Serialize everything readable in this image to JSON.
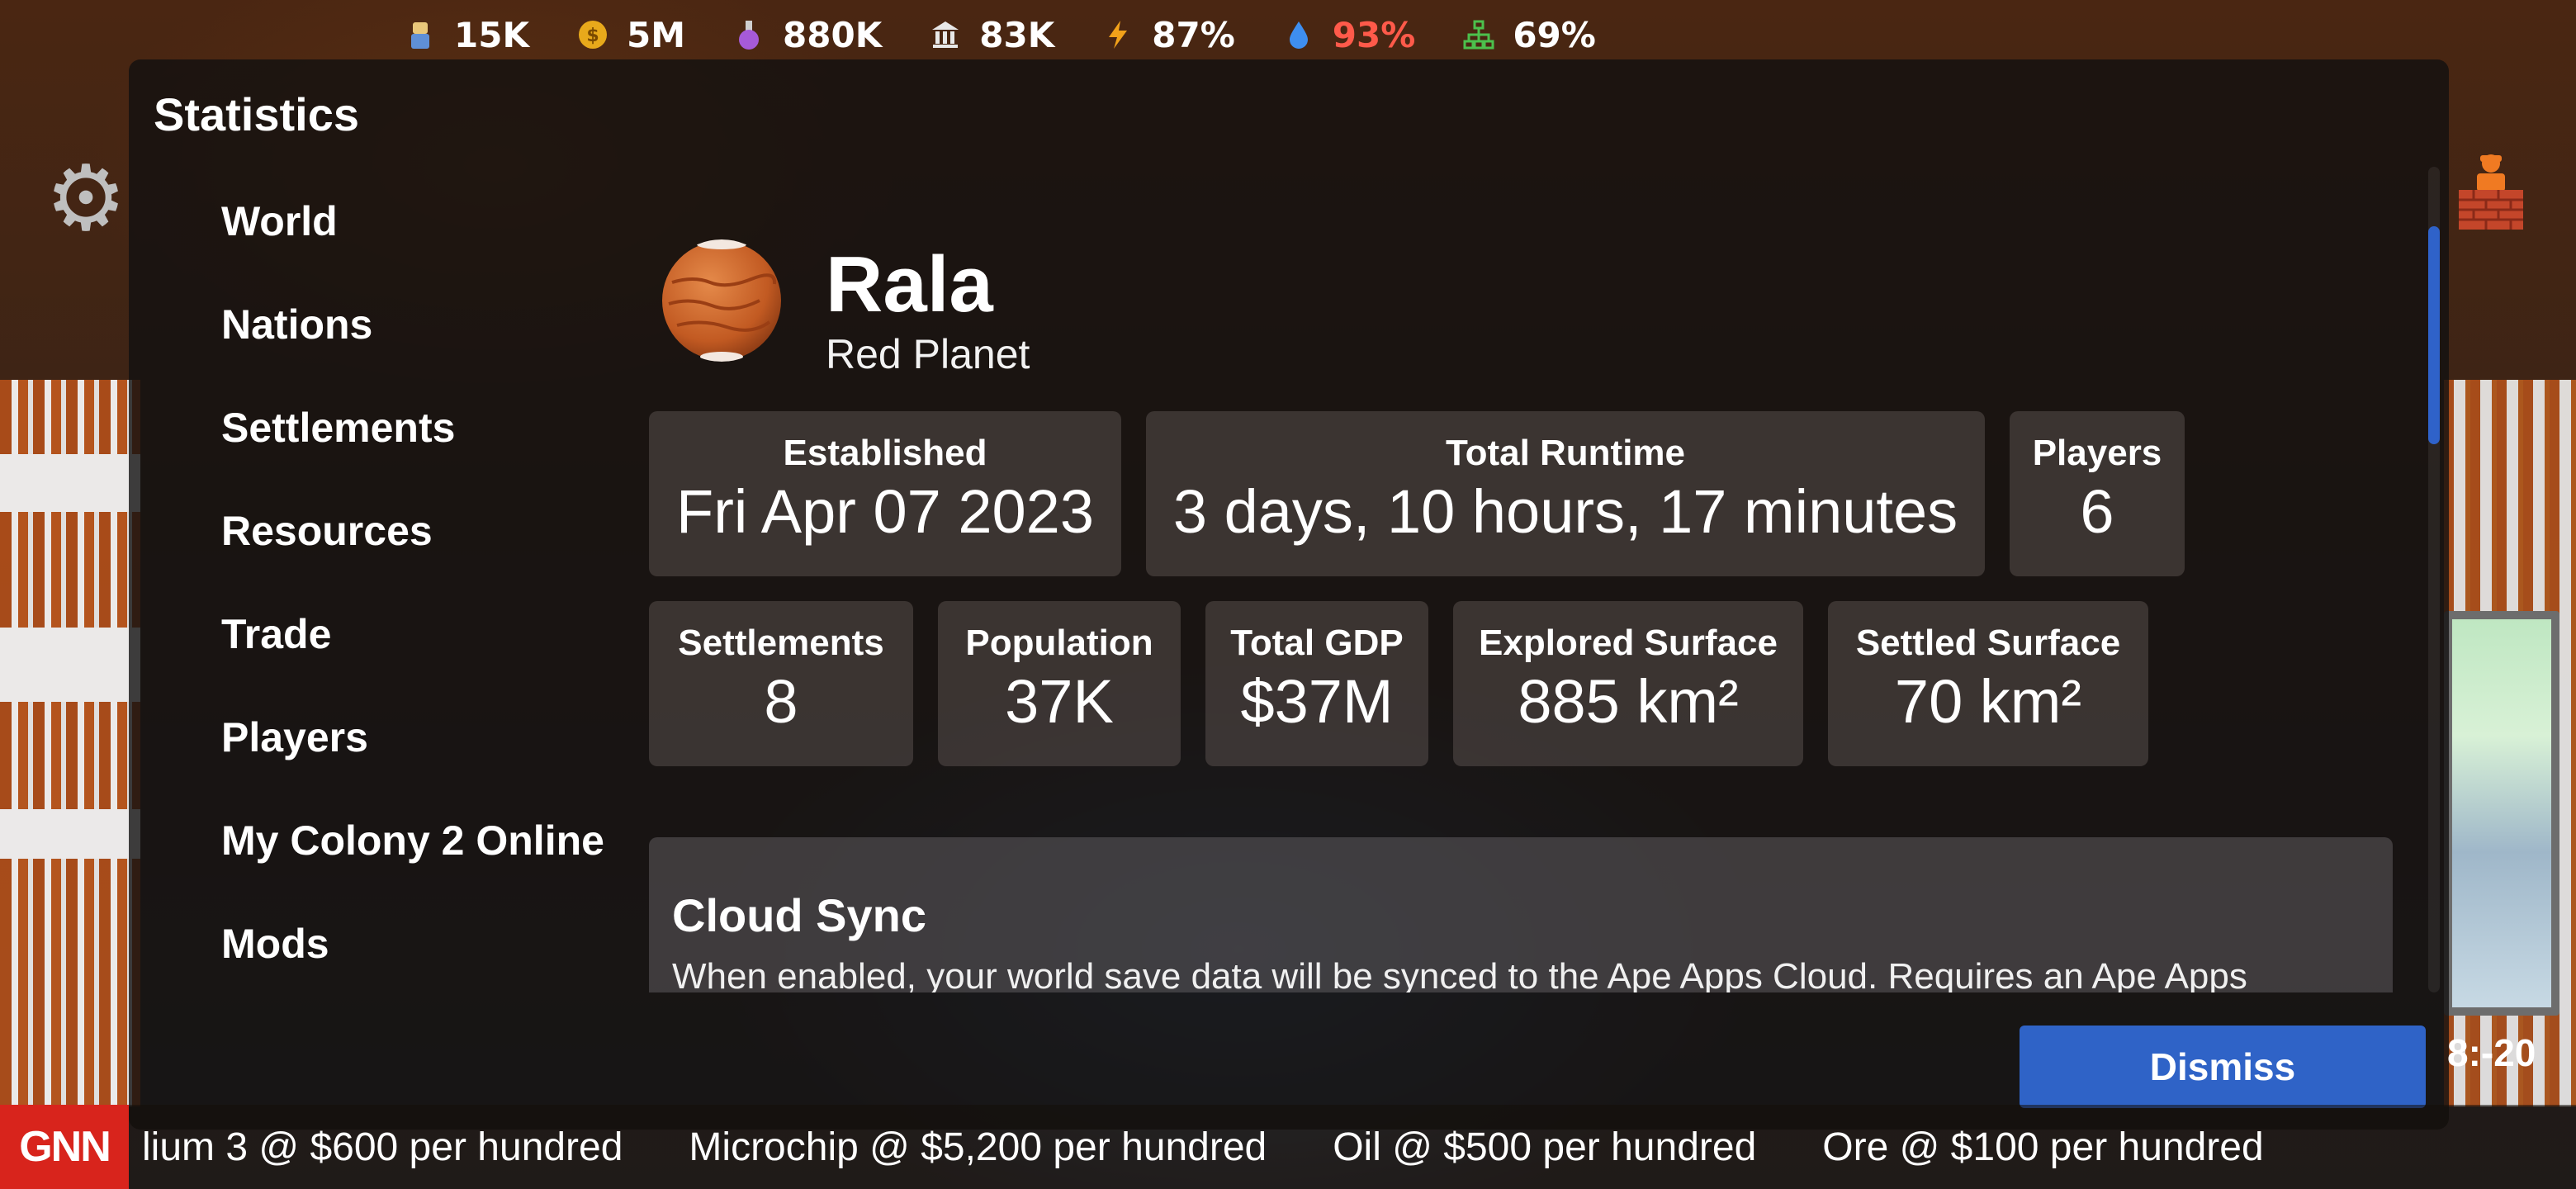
{
  "resources": [
    {
      "icon": "colonist-icon",
      "value": "15K",
      "color": "#ffffff"
    },
    {
      "icon": "coin-icon",
      "value": "5M",
      "color": "#ffffff"
    },
    {
      "icon": "potion-icon",
      "value": "880K",
      "color": "#ffffff"
    },
    {
      "icon": "bank-icon",
      "value": "83K",
      "color": "#ffffff"
    },
    {
      "icon": "lightning-icon",
      "value": "87%",
      "color": "#ffffff"
    },
    {
      "icon": "water-drop-icon",
      "value": "93%",
      "color": "#ff5a4a"
    },
    {
      "icon": "network-icon",
      "value": "69%",
      "color": "#ffffff"
    }
  ],
  "modal": {
    "title": "Statistics",
    "sidebar": [
      "World",
      "Nations",
      "Settlements",
      "Resources",
      "Trade",
      "Players",
      "My Colony 2 Online",
      "Mods"
    ],
    "planet": {
      "name": "Rala",
      "type": "Red Planet"
    },
    "stats_row1": [
      {
        "label": "Established",
        "value": "Fri Apr 07 2023"
      },
      {
        "label": "Total Runtime",
        "value": "3 days, 10 hours, 17 minutes"
      },
      {
        "label": "Players",
        "value": "6"
      }
    ],
    "stats_row2": [
      {
        "label": "Settlements",
        "value": "8"
      },
      {
        "label": "Population",
        "value": "37K"
      },
      {
        "label": "Total GDP",
        "value": "$37M"
      },
      {
        "label": "Explored Surface",
        "value": "885 km²"
      },
      {
        "label": "Settled Surface",
        "value": "70 km²"
      }
    ],
    "cloud_sync": {
      "title": "Cloud Sync",
      "description": "When enabled, your world save data will be synced to the Ape Apps Cloud. Requires an Ape Apps Account. You will also need an online connection to play this world.",
      "state": "On"
    },
    "dismiss_label": "Dismiss"
  },
  "timer": "8:-20",
  "ticker": {
    "label": "GNN",
    "items": [
      "lium 3 @ $600 per hundred",
      "Microchip @ $5,200 per hundred",
      "Oil @ $500 per hundred",
      "Ore @ $100 per hundred"
    ]
  },
  "colors": {
    "accent": "#2f63c7",
    "news": "#d8241c",
    "toggle_on": "#4fb24f"
  }
}
